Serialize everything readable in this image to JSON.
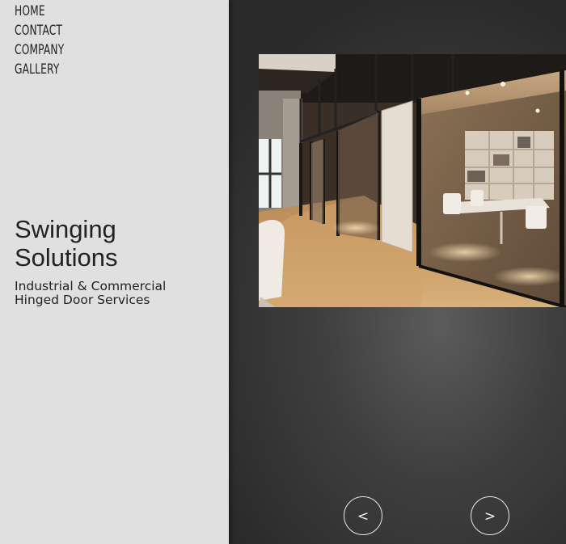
{
  "nav": {
    "items": [
      {
        "label": "HOME"
      },
      {
        "label": "CONTACT"
      },
      {
        "label": "COMPANY"
      },
      {
        "label": "GALLERY"
      }
    ]
  },
  "brand": {
    "title": "Swinging Solutions",
    "subtitle": "Industrial & Commercial Hinged Door Services"
  },
  "slider": {
    "image_subject": "office-interior-glass-doors",
    "prev_label": "<",
    "next_label": ">"
  },
  "colors": {
    "sidebar_bg": "#e0e0e0",
    "stage_bg": "#2e2e2e",
    "text": "#222222",
    "control_outline": "#e8e8e8"
  }
}
